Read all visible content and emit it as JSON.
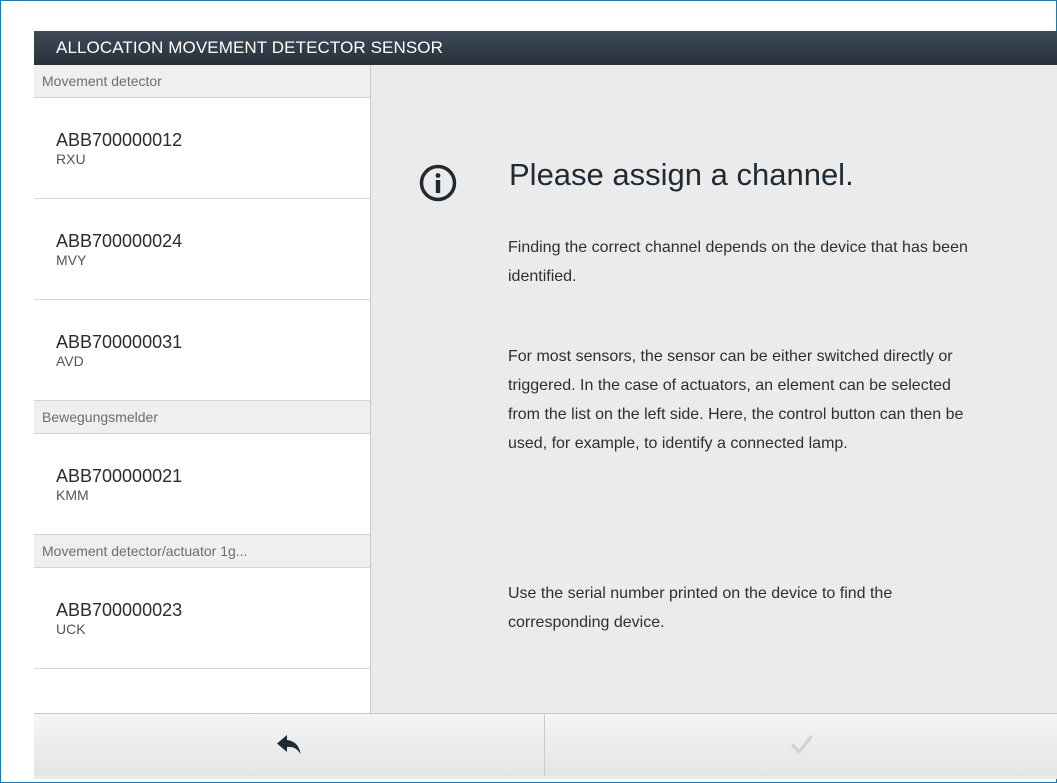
{
  "dialog": {
    "title": "ALLOCATION MOVEMENT DETECTOR SENSOR"
  },
  "groups": [
    {
      "header": "Movement detector",
      "items": [
        {
          "serial": "ABB700000012",
          "code": "RXU"
        },
        {
          "serial": "ABB700000024",
          "code": "MVY"
        },
        {
          "serial": "ABB700000031",
          "code": "AVD"
        }
      ]
    },
    {
      "header": "Bewegungsmelder",
      "items": [
        {
          "serial": "ABB700000021",
          "code": "KMM"
        }
      ]
    },
    {
      "header": "Movement detector/actuator 1g...",
      "items": [
        {
          "serial": "ABB700000023",
          "code": "UCK"
        }
      ]
    }
  ],
  "info": {
    "icon": "info-icon",
    "heading": "Please assign a channel.",
    "paragraphs": [
      "Finding the correct channel depends on the device that has been identified.",
      "For most sensors, the sensor can be either switched directly or triggered. In the case of actuators, an element can be selected from the list on the left side. Here, the control button can then be used, for example, to identify a connected lamp.",
      "Use the serial number printed on the device to find the corresponding device."
    ]
  },
  "footer": {
    "back_icon": "back-arrow-icon",
    "confirm_icon": "checkmark-icon",
    "confirm_state": "disabled"
  },
  "colors": {
    "frame_border": "#1a7aa8",
    "titlebar": "#2f3a44",
    "content_bg": "#ebebeb",
    "icon_dark": "#1f2a33",
    "disabled_check": "#d2d2d2"
  }
}
